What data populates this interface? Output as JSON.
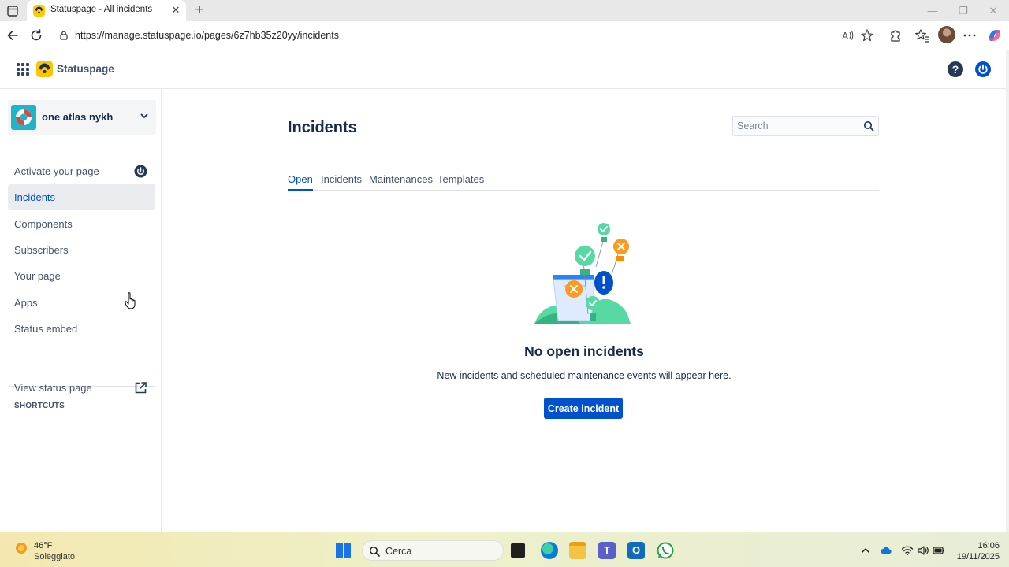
{
  "browser": {
    "tab_title": "Statuspage - All incidents",
    "tab_close": "✕",
    "new_tab": "+",
    "url": "https://manage.statuspage.io/pages/6z7hb35z20yy/incidents",
    "window_controls": {
      "minimize": "—",
      "restore": "❐",
      "close": "✕"
    }
  },
  "app": {
    "name": "Statuspage",
    "help": "?"
  },
  "sidebar": {
    "page_name": "one atlas nykh",
    "items": [
      {
        "label": "Activate your page",
        "trailing_icon": "power-icon"
      },
      {
        "label": "Incidents",
        "active": true
      },
      {
        "label": "Components"
      },
      {
        "label": "Subscribers"
      },
      {
        "label": "Your page"
      },
      {
        "label": "Apps"
      },
      {
        "label": "Status embed"
      }
    ],
    "shortcuts_heading": "SHORTCUTS",
    "shortcuts": [
      {
        "label": "View status page",
        "trailing_icon": "external-link-icon"
      }
    ]
  },
  "main": {
    "title": "Incidents",
    "search_placeholder": "Search",
    "tabs": [
      {
        "label": "Open",
        "active": true
      },
      {
        "label": "Incidents"
      },
      {
        "label": "Maintenances"
      },
      {
        "label": "Templates"
      }
    ],
    "empty_title": "No open incidents",
    "empty_description": "New incidents and scheduled maintenance events will appear here.",
    "create_button": "Create incident"
  },
  "taskbar": {
    "weather_temp": "46°F",
    "weather_desc": "Soleggiato",
    "search_label": "Cerca",
    "time": "16:06",
    "date": "19/11/2025"
  },
  "colors": {
    "accent": "#0052cc",
    "brand_yellow": "#ffc400",
    "text_dark": "#172b4d",
    "text_muted": "#42526e"
  }
}
